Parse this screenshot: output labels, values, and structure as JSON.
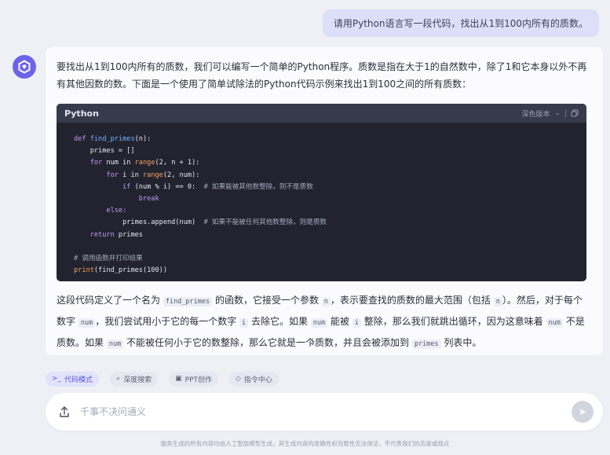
{
  "user_message": "请用Python语言写一段代码，找出从1到100内所有的质数。",
  "answer": {
    "intro": "要找出从1到100内所有的质数，我们可以编写一个简单的Python程序。质数是指在大于1的自然数中，除了1和它本身以外不再有其他因数的数。下面是一个使用了简单试除法的Python代码示例来找出1到100之间的所有质数：",
    "code": {
      "language": "Python",
      "theme_label": "深色版本",
      "lines": {
        "l1_def": "def ",
        "l1_fn": "find_primes",
        "l1_rest": "(n):",
        "l2": "    primes = []",
        "l3_for": "    for ",
        "l3_mid": "num in ",
        "l3_range": "range",
        "l3_args": "(2, n + 1):",
        "l4_for": "        for ",
        "l4_mid": "i in ",
        "l4_range": "range",
        "l4_args": "(2, num):",
        "l5_if": "            if ",
        "l5_cond": "(num % i) == 0:",
        "l5_comment": "  # 如果能被其他数整除，则不是质数",
        "l6": "                break",
        "l7": "        else:",
        "l8_code": "            primes.append(num)",
        "l8_comment": "  # 如果不能被任何其他数整除，则是质数",
        "l9_ret": "    return ",
        "l9_var": "primes",
        "l10_comment": "# 调用函数并打印结果",
        "l11_print": "print",
        "l11_rest": "(find_primes(100))"
      }
    },
    "explain": {
      "p1": "这段代码定义了一个名为 ",
      "fn_name": "find_primes",
      "p2": " 的函数，它接受一个参数 ",
      "param": "n",
      "p3": "，表示要查找的质数的最大范围（包括 ",
      "param2": "n",
      "p4": "）。然后，对于每个数字 ",
      "num": "num",
      "p5": "，我们尝试用小于它的每一个数字 ",
      "i": "i",
      "p6": " 去除它。如果 ",
      "num2": "num",
      "p7": " 能被 ",
      "i2": "i",
      "p8": " 整除，那么我们就跳出循环，因为这意味着 ",
      "num3": "num",
      "p9": " 不是质数。如果 ",
      "num4": "num",
      "p10": " 不能被任何小于它的数整除，那么它就是一个质数，并且会被添加到 ",
      "primes": "primes",
      "p11": " 列表中。"
    }
  },
  "toolbar": {
    "items": [
      {
        "icon": "code-icon",
        "label": "代码模式"
      },
      {
        "icon": "search-icon",
        "label": "深度搜索"
      },
      {
        "icon": "ppt-icon",
        "label": "PPT创作"
      },
      {
        "icon": "command-icon",
        "label": "指令中心"
      }
    ]
  },
  "input": {
    "placeholder": "千事不决问通义"
  },
  "footer": "服务生成的所有内容均由人工智能模型生成，其生成内容的准确性和完整性无法保证，不代表我们的态度或观点",
  "colors": {
    "accent": "#6c63e8",
    "code_bg": "#22232f",
    "user_bubble": "#dcdff7"
  }
}
